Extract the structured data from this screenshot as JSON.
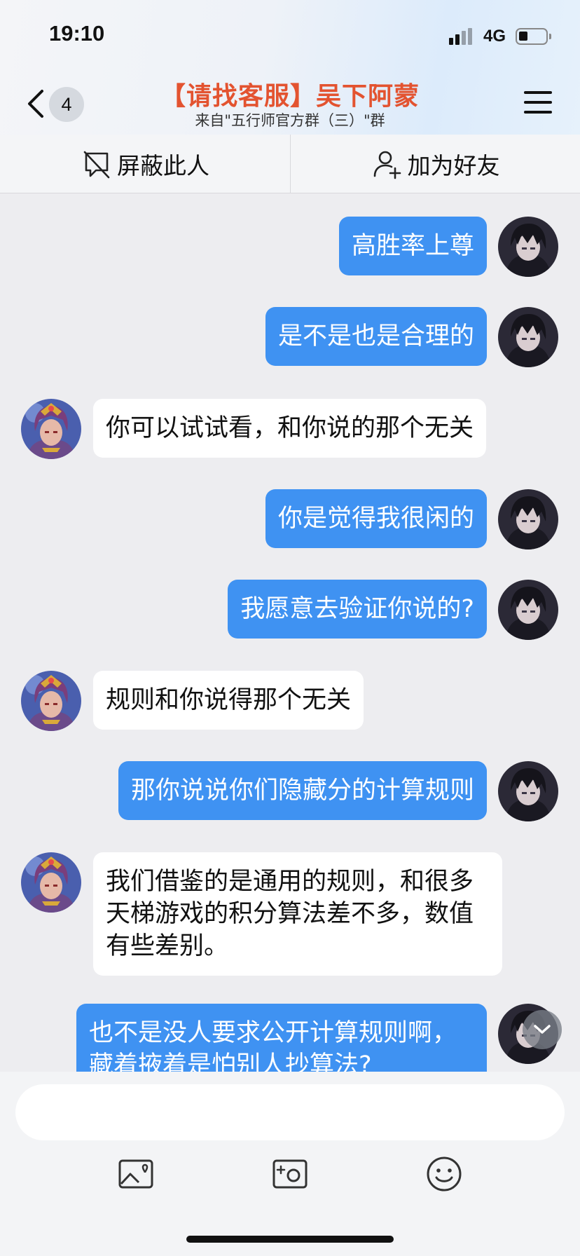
{
  "status": {
    "time": "19:10",
    "network": "4G"
  },
  "nav": {
    "back_count": "4",
    "title": "【请找客服】吴下阿蒙",
    "subtitle": "来自\"五行师官方群（三）\"群"
  },
  "actions": {
    "block_label": "屏蔽此人",
    "add_friend_label": "加为好友"
  },
  "messages": [
    {
      "from": "me",
      "text": "高胜率上尊"
    },
    {
      "from": "me",
      "text": "是不是也是合理的"
    },
    {
      "from": "them",
      "text": "你可以试试看，和你说的那个无关"
    },
    {
      "from": "me",
      "text": "你是觉得我很闲的"
    },
    {
      "from": "me",
      "text": "我愿意去验证你说的?"
    },
    {
      "from": "them",
      "text": "规则和你说得那个无关"
    },
    {
      "from": "me",
      "text": "那你说说你们隐藏分的计算规则"
    },
    {
      "from": "them",
      "text": "我们借鉴的是通用的规则，和很多天梯游戏的积分算法差不多，数值有些差别。"
    },
    {
      "from": "me",
      "text": "也不是没人要求公开计算规则啊，藏着掖着是怕别人抄算法?"
    }
  ],
  "input": {
    "placeholder": ""
  },
  "icons": {
    "back": "chevron-left-icon",
    "menu": "menu-icon",
    "block": "block-user-icon",
    "add_friend": "add-user-icon",
    "image": "image-icon",
    "camera": "camera-icon",
    "emoji": "emoji-icon",
    "scroll": "chevron-down-icon"
  },
  "colors": {
    "title": "#e35330",
    "my_bubble": "#3f92f2",
    "their_bubble": "#ffffff"
  }
}
